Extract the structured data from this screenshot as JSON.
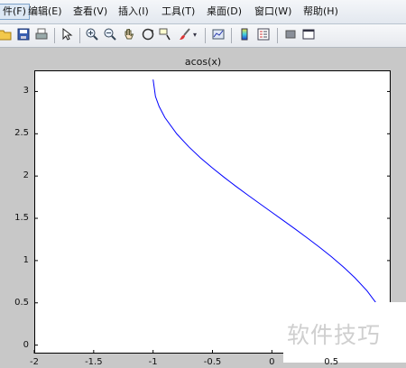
{
  "menu": {
    "items": [
      "件(F)",
      "编辑(E)",
      "查看(V)",
      "插入(I)",
      "工具(T)",
      "桌面(D)",
      "窗口(W)",
      "帮助(H)"
    ]
  },
  "toolbar": {
    "icons": [
      "open-folder-icon",
      "save-icon",
      "print-icon",
      "select-arrow-icon",
      "zoom-in-icon",
      "zoom-out-icon",
      "pan-hand-icon",
      "rotate-3d-icon",
      "data-cursor-icon",
      "brush-icon",
      "dropdown-arrow-icon",
      "link-plot-icon",
      "colorbar-icon",
      "legend-icon",
      "hide-plot-tools-icon",
      "show-plot-tools-icon"
    ]
  },
  "chart_data": {
    "type": "line",
    "title": "acos(x)",
    "xlabel": "",
    "ylabel": "",
    "xlim": [
      -2,
      1
    ],
    "ylim": [
      -0.1,
      3.25
    ],
    "xticks": [
      "-2",
      "-1.5",
      "-1",
      "-0.5",
      "0",
      "0.5"
    ],
    "yticks": [
      "0",
      "0.5",
      "1",
      "1.5",
      "2",
      "2.5",
      "3"
    ],
    "series": [
      {
        "color": "#0000ff",
        "x": [
          -1,
          -0.98,
          -0.95,
          -0.9,
          -0.8,
          -0.7,
          -0.6,
          -0.5,
          -0.4,
          -0.3,
          -0.2,
          -0.1,
          0,
          0.1,
          0.2,
          0.3,
          0.4,
          0.5,
          0.6,
          0.7,
          0.8,
          0.877
        ],
        "y": [
          3.1416,
          2.9413,
          2.824,
          2.6906,
          2.4981,
          2.3462,
          2.2143,
          2.0944,
          1.9823,
          1.8755,
          1.7722,
          1.671,
          1.5708,
          1.4706,
          1.3694,
          1.2661,
          1.1593,
          1.0472,
          0.9273,
          0.7954,
          0.6435,
          0.5
        ]
      }
    ]
  },
  "watermark": "软件技巧",
  "colors": {
    "figure_bg": "#c8c8c8",
    "axes_bg": "#ffffff",
    "line": "#0000ff"
  }
}
